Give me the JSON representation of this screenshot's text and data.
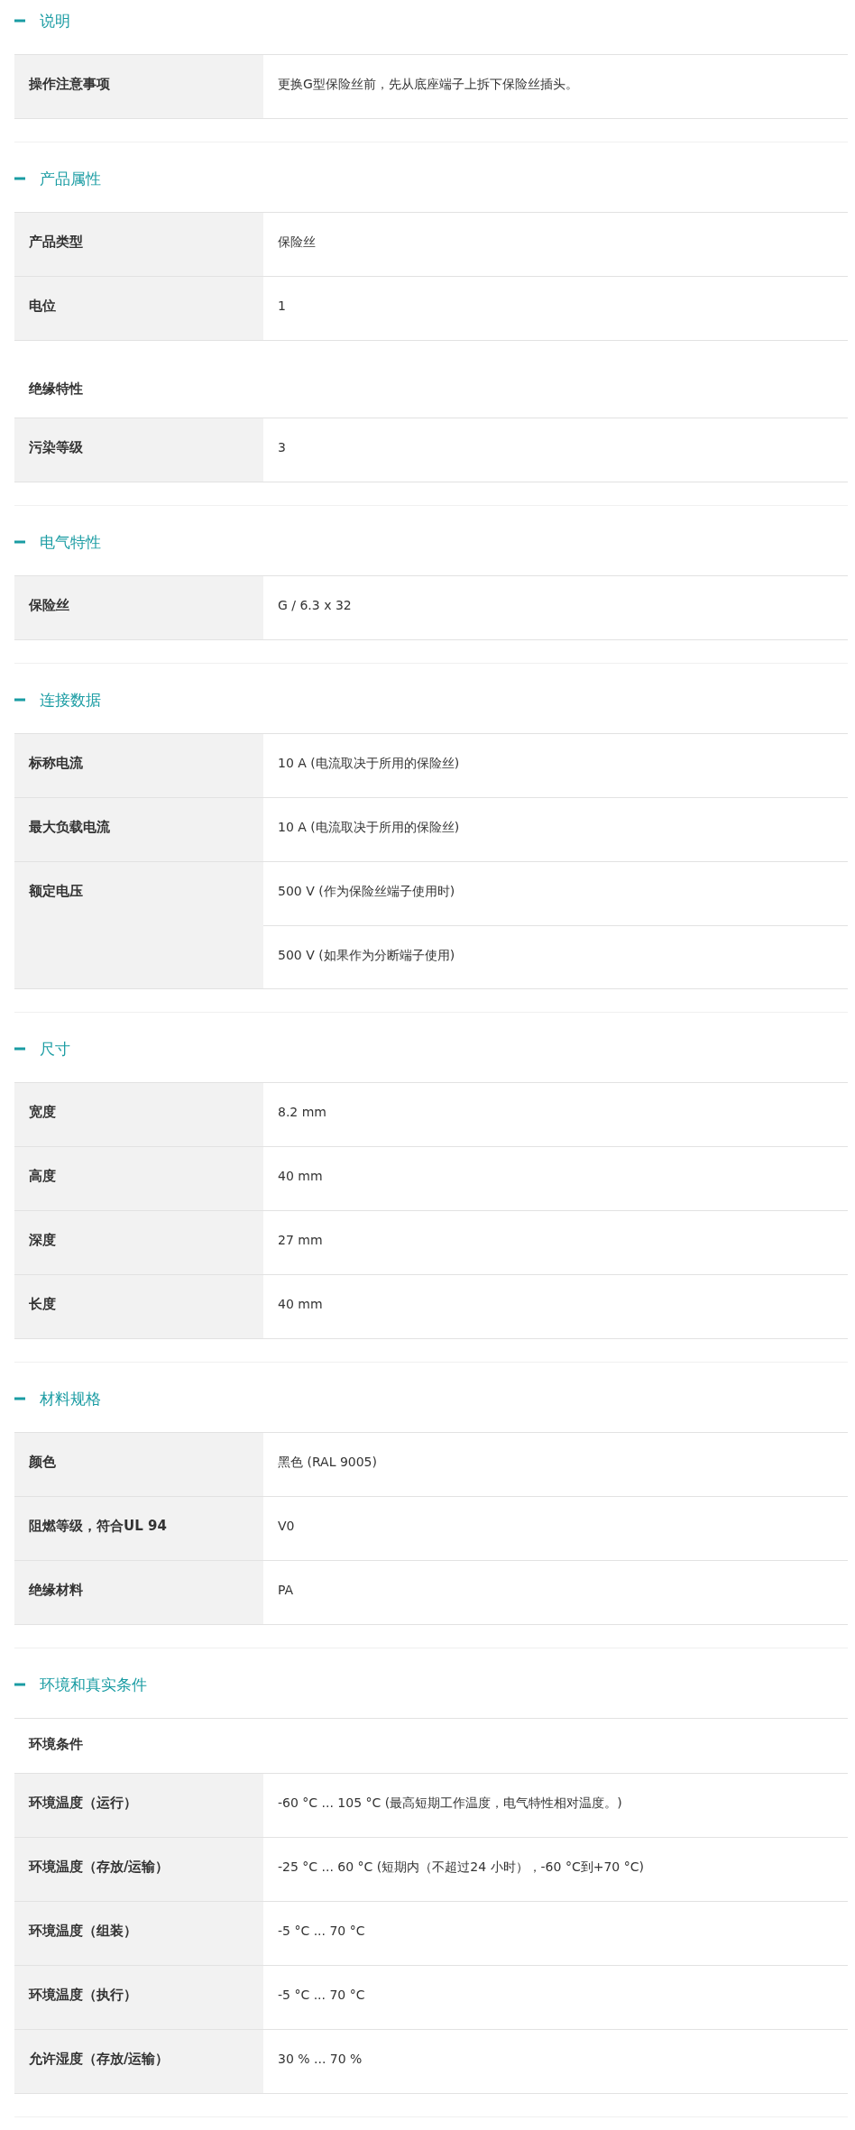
{
  "sections": [
    {
      "title": "说明",
      "expanded": true,
      "items": [
        {
          "kind": "row",
          "label": "操作注意事项",
          "values": [
            "更换G型保险丝前，先从底座端子上拆下保险丝插头。"
          ]
        }
      ]
    },
    {
      "title": "产品属性",
      "expanded": true,
      "items": [
        {
          "kind": "row",
          "label": "产品类型",
          "values": [
            "保险丝"
          ]
        },
        {
          "kind": "row",
          "label": "电位",
          "values": [
            "1"
          ]
        },
        {
          "kind": "heading",
          "label": "绝缘特性"
        },
        {
          "kind": "row",
          "label": "污染等级",
          "values": [
            "3"
          ]
        }
      ]
    },
    {
      "title": "电气特性",
      "expanded": true,
      "items": [
        {
          "kind": "row",
          "label": "保险丝",
          "values": [
            "G / 6.3 x 32"
          ]
        }
      ]
    },
    {
      "title": "连接数据",
      "expanded": true,
      "items": [
        {
          "kind": "row",
          "label": "标称电流",
          "values": [
            "10 A (电流取决于所用的保险丝)"
          ]
        },
        {
          "kind": "row",
          "label": "最大负载电流",
          "values": [
            "10 A (电流取决于所用的保险丝)"
          ]
        },
        {
          "kind": "row",
          "label": "额定电压",
          "values": [
            "500 V (作为保险丝端子使用时)",
            "500 V (如果作为分断端子使用)"
          ]
        }
      ]
    },
    {
      "title": "尺寸",
      "expanded": true,
      "items": [
        {
          "kind": "row",
          "label": "宽度",
          "values": [
            "8.2 mm"
          ]
        },
        {
          "kind": "row",
          "label": "高度",
          "values": [
            "40 mm"
          ]
        },
        {
          "kind": "row",
          "label": "深度",
          "values": [
            "27 mm"
          ]
        },
        {
          "kind": "row",
          "label": "长度",
          "values": [
            "40 mm"
          ]
        }
      ]
    },
    {
      "title": "材料规格",
      "expanded": true,
      "items": [
        {
          "kind": "row",
          "label": "颜色",
          "values": [
            "黑色 (RAL 9005)"
          ]
        },
        {
          "kind": "row",
          "label": "阻燃等级，符合UL 94",
          "values": [
            "V0"
          ]
        },
        {
          "kind": "row",
          "label": "绝缘材料",
          "values": [
            "PA"
          ]
        }
      ]
    },
    {
      "title": "环境和真实条件",
      "expanded": true,
      "items": [
        {
          "kind": "heading",
          "label": "环境条件"
        },
        {
          "kind": "row",
          "label": "环境温度（运行）",
          "values": [
            "-60 °C ... 105 °C (最高短期工作温度，电气特性相对温度。)"
          ]
        },
        {
          "kind": "row",
          "label": "环境温度（存放/运输）",
          "values": [
            "-25 °C ... 60 °C (短期内（不超过24  小时），-60 °C到+70 °C)"
          ]
        },
        {
          "kind": "row",
          "label": "环境温度（组装）",
          "values": [
            "-5 °C ... 70 °C"
          ]
        },
        {
          "kind": "row",
          "label": "环境温度（执行）",
          "values": [
            "-5 °C ... 70 °C"
          ]
        },
        {
          "kind": "row",
          "label": "允许湿度（存放/运输）",
          "values": [
            "30 % ... 70 %"
          ]
        }
      ]
    }
  ]
}
